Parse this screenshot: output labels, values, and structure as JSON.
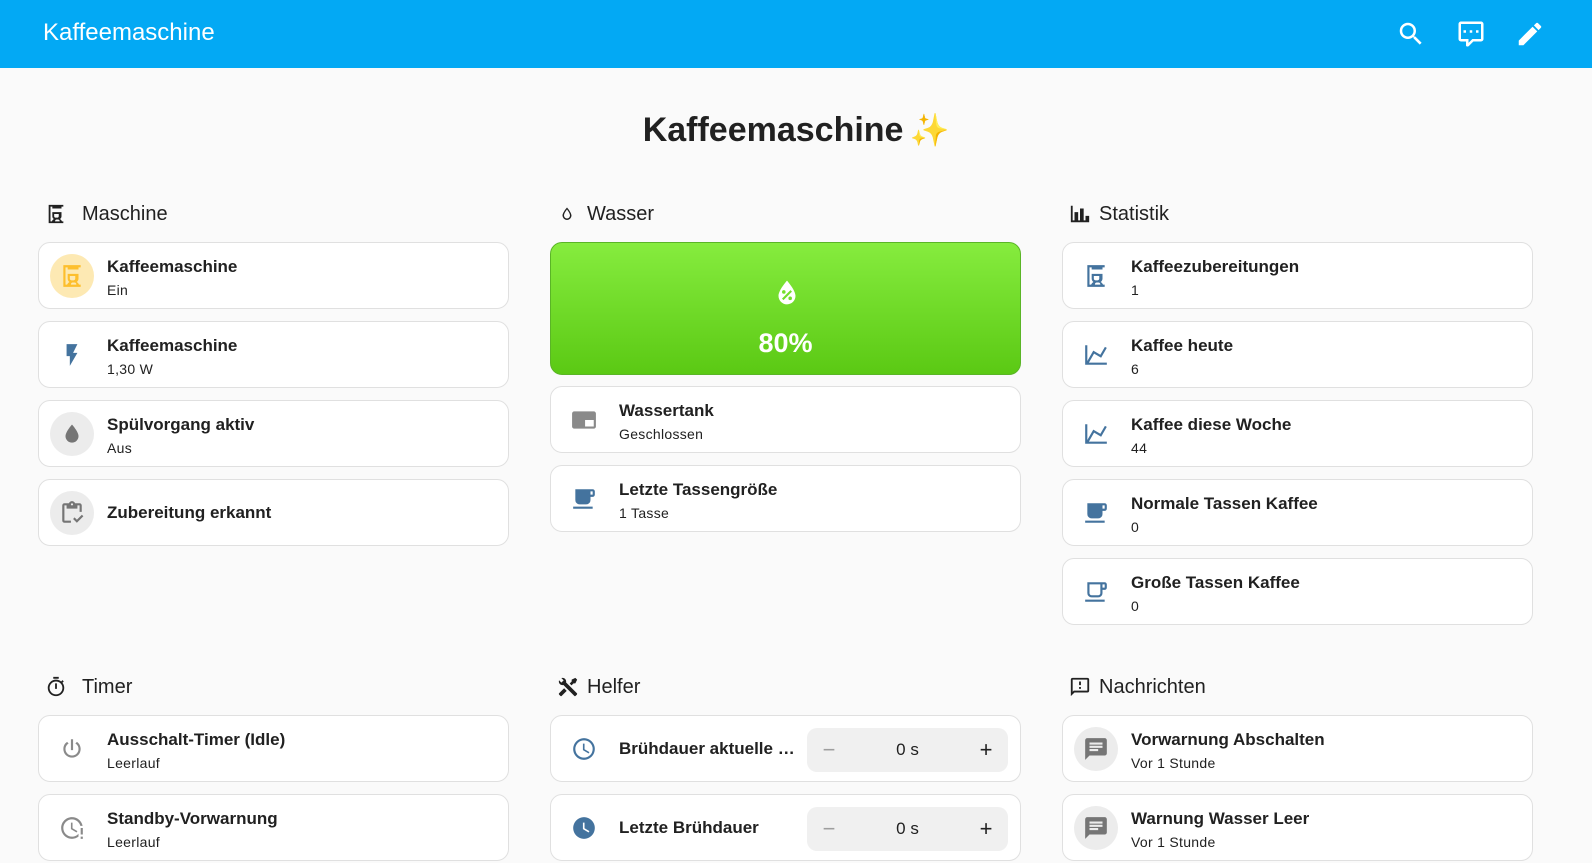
{
  "app": {
    "title": "Kaffeemaschine",
    "header_icons": [
      "search-icon",
      "assist-chat-icon",
      "edit-pencil-icon"
    ]
  },
  "dashboard": {
    "title": "Kaffeemaschine",
    "title_emoji": "✨"
  },
  "sections": {
    "maschine": {
      "title": "Maschine",
      "icon": "coffee-maker-icon",
      "cards": [
        {
          "name": "Kaffeemaschine",
          "state": "Ein",
          "icon": "coffee-maker-icon"
        },
        {
          "name": "Kaffeemaschine",
          "state": "1,30 W",
          "icon": "flash-icon"
        },
        {
          "name": "Spülvorgang aktiv",
          "state": "Aus",
          "icon": "water-drop-icon"
        },
        {
          "name": "Zubereitung erkannt",
          "state": "",
          "icon": "clipboard-check-icon"
        }
      ]
    },
    "wasser": {
      "title": "Wasser",
      "icon": "water-outline-icon",
      "gauge": {
        "value": "80%",
        "level": 0.8,
        "icon": "water-percent-icon",
        "color": "#5bc914"
      },
      "cards": [
        {
          "name": "Wassertank",
          "state": "Geschlossen",
          "icon": "window-closed-icon"
        },
        {
          "name": "Letzte Tassengröße",
          "state": "1 Tasse",
          "icon": "coffee-cup-icon"
        }
      ]
    },
    "statistik": {
      "title": "Statistik",
      "icon": "chart-bar-icon",
      "cards": [
        {
          "name": "Kaffeezubereitungen",
          "state": "1",
          "icon": "coffee-maker-icon"
        },
        {
          "name": "Kaffee heute",
          "state": "6",
          "icon": "chart-line-icon"
        },
        {
          "name": "Kaffee diese Woche",
          "state": "44",
          "icon": "chart-line-icon"
        },
        {
          "name": "Normale Tassen Kaffee",
          "state": "0",
          "icon": "coffee-cup-icon"
        },
        {
          "name": "Große Tassen Kaffee",
          "state": "0",
          "icon": "coffee-cup-outline-icon"
        }
      ]
    },
    "timer": {
      "title": "Timer",
      "icon": "timer-icon",
      "cards": [
        {
          "name": "Ausschalt-Timer (Idle)",
          "state": "Leerlauf",
          "icon": "power-icon"
        },
        {
          "name": "Standby-Vorwarnung",
          "state": "Leerlauf",
          "icon": "clock-alert-icon"
        }
      ]
    },
    "helfer": {
      "title": "Helfer",
      "icon": "tools-icon",
      "cards": [
        {
          "name": "Brühdauer aktuelle Z...",
          "value": "0 s",
          "minus": "−",
          "plus": "+",
          "icon": "clock-outline-icon"
        },
        {
          "name": "Letzte Brühdauer",
          "value": "0 s",
          "minus": "−",
          "plus": "+",
          "icon": "clock-filled-icon"
        }
      ]
    },
    "nachrichten": {
      "title": "Nachrichten",
      "icon": "message-alert-icon",
      "cards": [
        {
          "name": "Vorwarnung Abschalten",
          "state": "Vor 1 Stunde",
          "icon": "message-text-icon"
        },
        {
          "name": "Warnung Wasser Leer",
          "state": "Vor 1 Stunde",
          "icon": "message-text-icon"
        }
      ]
    }
  },
  "colors": {
    "header": "#03a9f4",
    "icon_blue": "#44739e",
    "active_yellow": "#fdbf2d",
    "gauge_green": "#5bc914"
  }
}
